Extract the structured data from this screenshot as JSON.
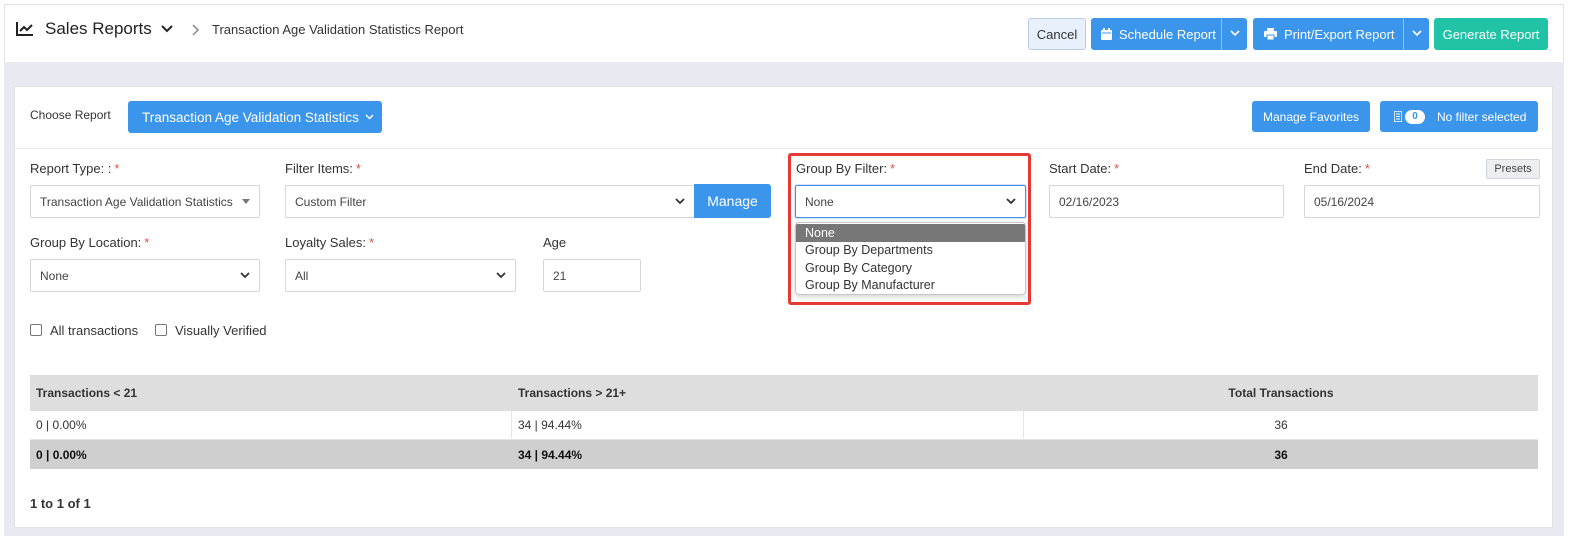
{
  "header": {
    "app_title": "Sales Reports",
    "breadcrumb": "Transaction Age Validation Statistics Report",
    "buttons": {
      "cancel": "Cancel",
      "schedule": "Schedule Report",
      "print_export": "Print/Export Report",
      "generate": "Generate Report"
    }
  },
  "choose": {
    "label": "Choose Report",
    "selected": "Transaction Age Validation Statistics",
    "manage_favorites": "Manage Favorites",
    "filter_count": "0",
    "filter_status": "No filter selected"
  },
  "form": {
    "report_type": {
      "label": "Report Type: :",
      "value": "Transaction Age Validation Statistics"
    },
    "filter_items": {
      "label": "Filter Items:",
      "value": "Custom Filter",
      "manage": "Manage"
    },
    "group_by_filter": {
      "label": "Group By Filter:",
      "value": "None",
      "options": [
        "None",
        "Group By Departments",
        "Group By Category",
        "Group By Manufacturer"
      ]
    },
    "start_date": {
      "label": "Start Date:",
      "value": "02/16/2023"
    },
    "end_date": {
      "label": "End Date:",
      "value": "05/16/2024",
      "presets": "Presets"
    },
    "group_by_location": {
      "label": "Group By Location:",
      "value": "None"
    },
    "loyalty_sales": {
      "label": "Loyalty Sales:",
      "value": "All"
    },
    "age": {
      "label": "Age",
      "value": "21"
    },
    "required_mark": "*",
    "checkboxes": {
      "all_transactions": "All transactions",
      "visually_verified": "Visually Verified"
    }
  },
  "table": {
    "headers": [
      "Transactions < 21",
      "Transactions > 21+",
      "Total Transactions"
    ],
    "rows": [
      [
        "0 | 0.00%",
        "34 | 94.44%",
        "36"
      ]
    ],
    "totals": [
      "0 | 0.00%",
      "34 | 94.44%",
      "36"
    ]
  },
  "pager": "1 to 1 of 1"
}
